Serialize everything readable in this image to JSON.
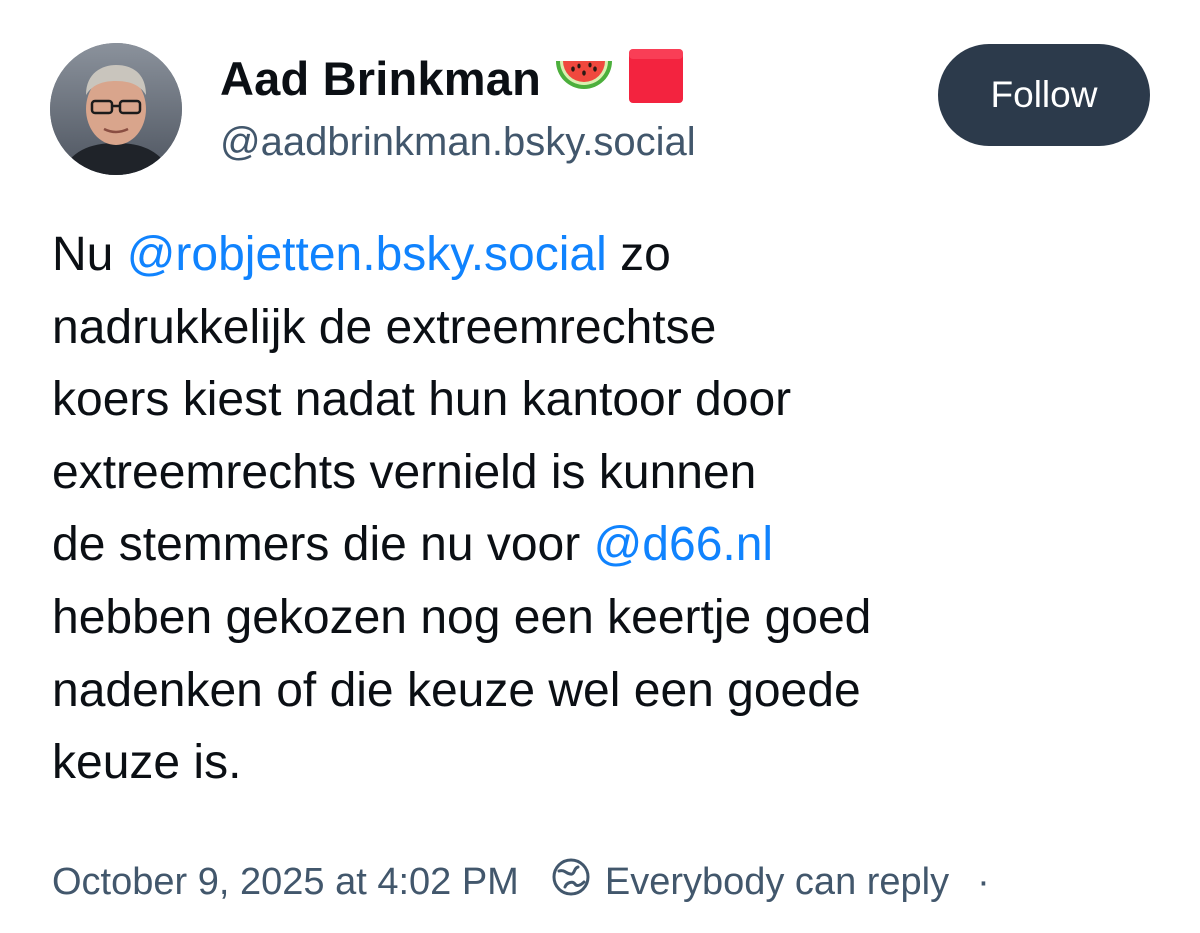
{
  "author": {
    "display_name": "Aad Brinkman",
    "handle": "@aadbrinkman.bsky.social",
    "emojis": [
      "watermelon-icon",
      "red-square-icon"
    ]
  },
  "actions": {
    "follow_label": "Follow"
  },
  "post": {
    "lines": [
      [
        {
          "text": "Nu "
        },
        {
          "text": "@robjetten.bsky.social",
          "mention": true
        },
        {
          "text": " zo"
        }
      ],
      [
        {
          "text": "nadrukkelijk de extreemrechtse"
        }
      ],
      [
        {
          "text": "koers kiest nadat hun kantoor door"
        }
      ],
      [
        {
          "text": "extreemrechts vernield is kunnen"
        }
      ],
      [
        {
          "text": "de stemmers die nu voor "
        },
        {
          "text": "@d66.nl",
          "mention": true
        }
      ],
      [
        {
          "text": "hebben gekozen nog een keertje goed"
        }
      ],
      [
        {
          "text": "nadenken of die keuze wel een goede"
        }
      ],
      [
        {
          "text": "keuze is."
        }
      ]
    ]
  },
  "meta": {
    "timestamp": "October 9, 2025 at 4:02 PM",
    "reply_setting": "Everybody can reply",
    "separator": "·"
  },
  "colors": {
    "mention": "#1083fe",
    "muted": "#42576c",
    "button_bg": "#2c3a4b"
  }
}
